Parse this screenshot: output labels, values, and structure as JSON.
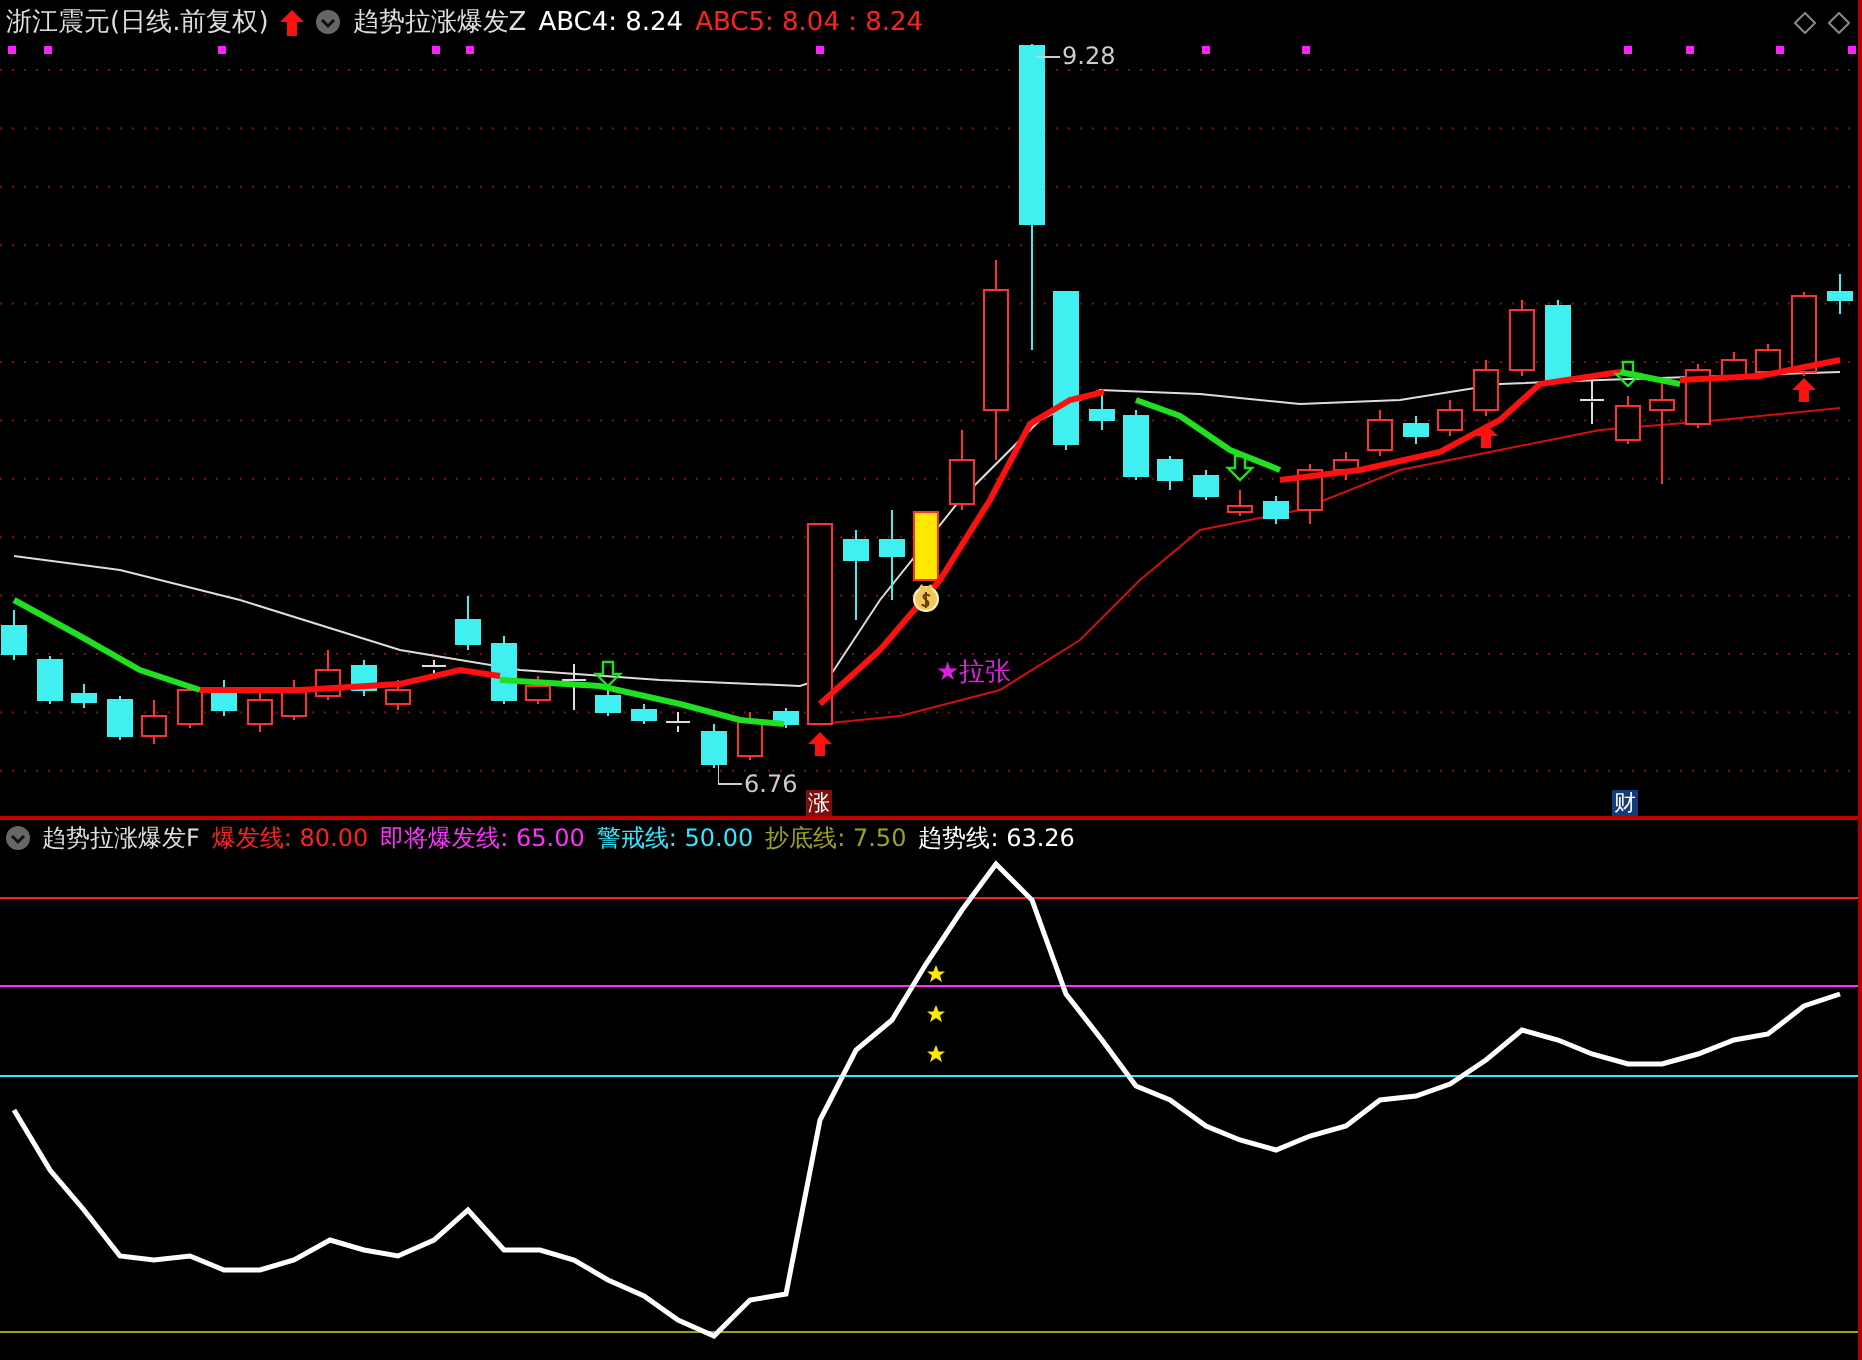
{
  "main_panel": {
    "title": "浙江震元(日线.前复权)",
    "indicator": "趋势拉涨爆发Z",
    "readings": [
      {
        "text": "ABC4: 8.24",
        "color": "#ffffff"
      },
      {
        "text": "ABC5: 8.04 : 8.24",
        "color": "#ff2020"
      }
    ],
    "price_high": "9.28",
    "price_low": "6.76",
    "signal_label": "★拉张",
    "badges": [
      {
        "text": "涨",
        "color": "#7a1010"
      },
      {
        "text": "财",
        "color": "#143c78"
      }
    ]
  },
  "sub_panel": {
    "indicator": "趋势拉涨爆发F",
    "legend": [
      {
        "label": "爆发线:",
        "value": "80.00",
        "color": "#ff2020"
      },
      {
        "label": "即将爆发线:",
        "value": "65.00",
        "color": "#ff30ff"
      },
      {
        "label": "警戒线:",
        "value": "50.00",
        "color": "#30e8ff"
      },
      {
        "label": "抄底线:",
        "value": "7.50",
        "color": "#a0a020"
      },
      {
        "label": "趋势线:",
        "value": "63.26",
        "color": "#ffffff"
      }
    ]
  }
}
